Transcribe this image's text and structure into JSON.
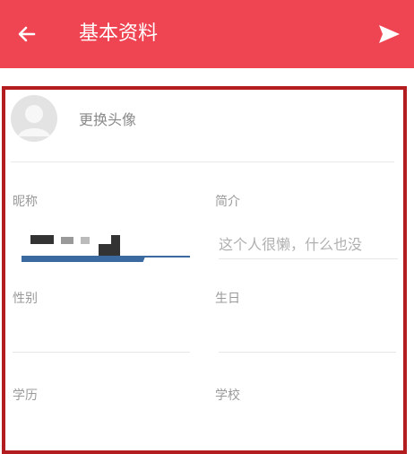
{
  "header": {
    "title": "基本资料",
    "back_icon": "arrow-left-icon",
    "send_icon": "send-icon",
    "background": "#ef4452"
  },
  "avatar": {
    "label": "更换头像",
    "icon": "user-avatar-icon"
  },
  "fields": {
    "nickname": {
      "label": "昵称",
      "value": ""
    },
    "intro": {
      "label": "简介",
      "placeholder": "这个人很懒，什么也没"
    },
    "gender": {
      "label": "性别",
      "value": ""
    },
    "birthday": {
      "label": "生日",
      "value": ""
    },
    "education": {
      "label": "学历",
      "value": ""
    },
    "school": {
      "label": "学校",
      "value": ""
    }
  },
  "colors": {
    "highlight_border": "#b31d1f",
    "nickname_underline": "#3b6aa0"
  }
}
